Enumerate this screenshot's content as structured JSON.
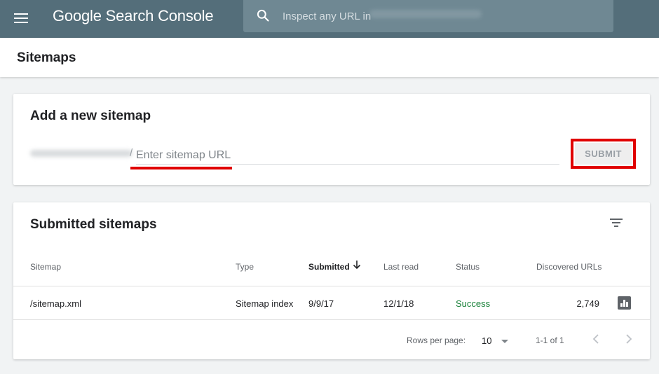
{
  "topbar": {
    "brand": "Google Search Console",
    "search_placeholder": "Inspect any URL in"
  },
  "page": {
    "title": "Sitemaps"
  },
  "add_sitemap": {
    "heading": "Add a new sitemap",
    "url_slash": "/",
    "input_placeholder": "Enter sitemap URL",
    "submit_label": "SUBMIT",
    "highlight_color": "#e00000"
  },
  "submitted": {
    "heading": "Submitted sitemaps",
    "columns": [
      "Sitemap",
      "Type",
      "Submitted",
      "Last read",
      "Status",
      "Discovered URLs"
    ],
    "sorted_column": "Submitted",
    "rows": [
      {
        "sitemap": "/sitemap.xml",
        "type": "Sitemap index",
        "submitted": "9/9/17",
        "last_read": "12/1/18",
        "status": "Success",
        "discovered_urls": "2,749"
      }
    ],
    "footer": {
      "rows_per_page_label": "Rows per page:",
      "rows_per_page_value": "10",
      "range": "1-1 of 1"
    }
  },
  "icons": {
    "menu": "menu-icon",
    "search": "search-icon",
    "filter": "filter-icon",
    "sort": "arrow-down-icon",
    "chart": "bar-chart-icon",
    "dropdown": "dropdown-icon",
    "prev": "chevron-left-icon",
    "next": "chevron-right-icon"
  },
  "colors": {
    "topbar": "#546e7a",
    "success": "#188038"
  }
}
